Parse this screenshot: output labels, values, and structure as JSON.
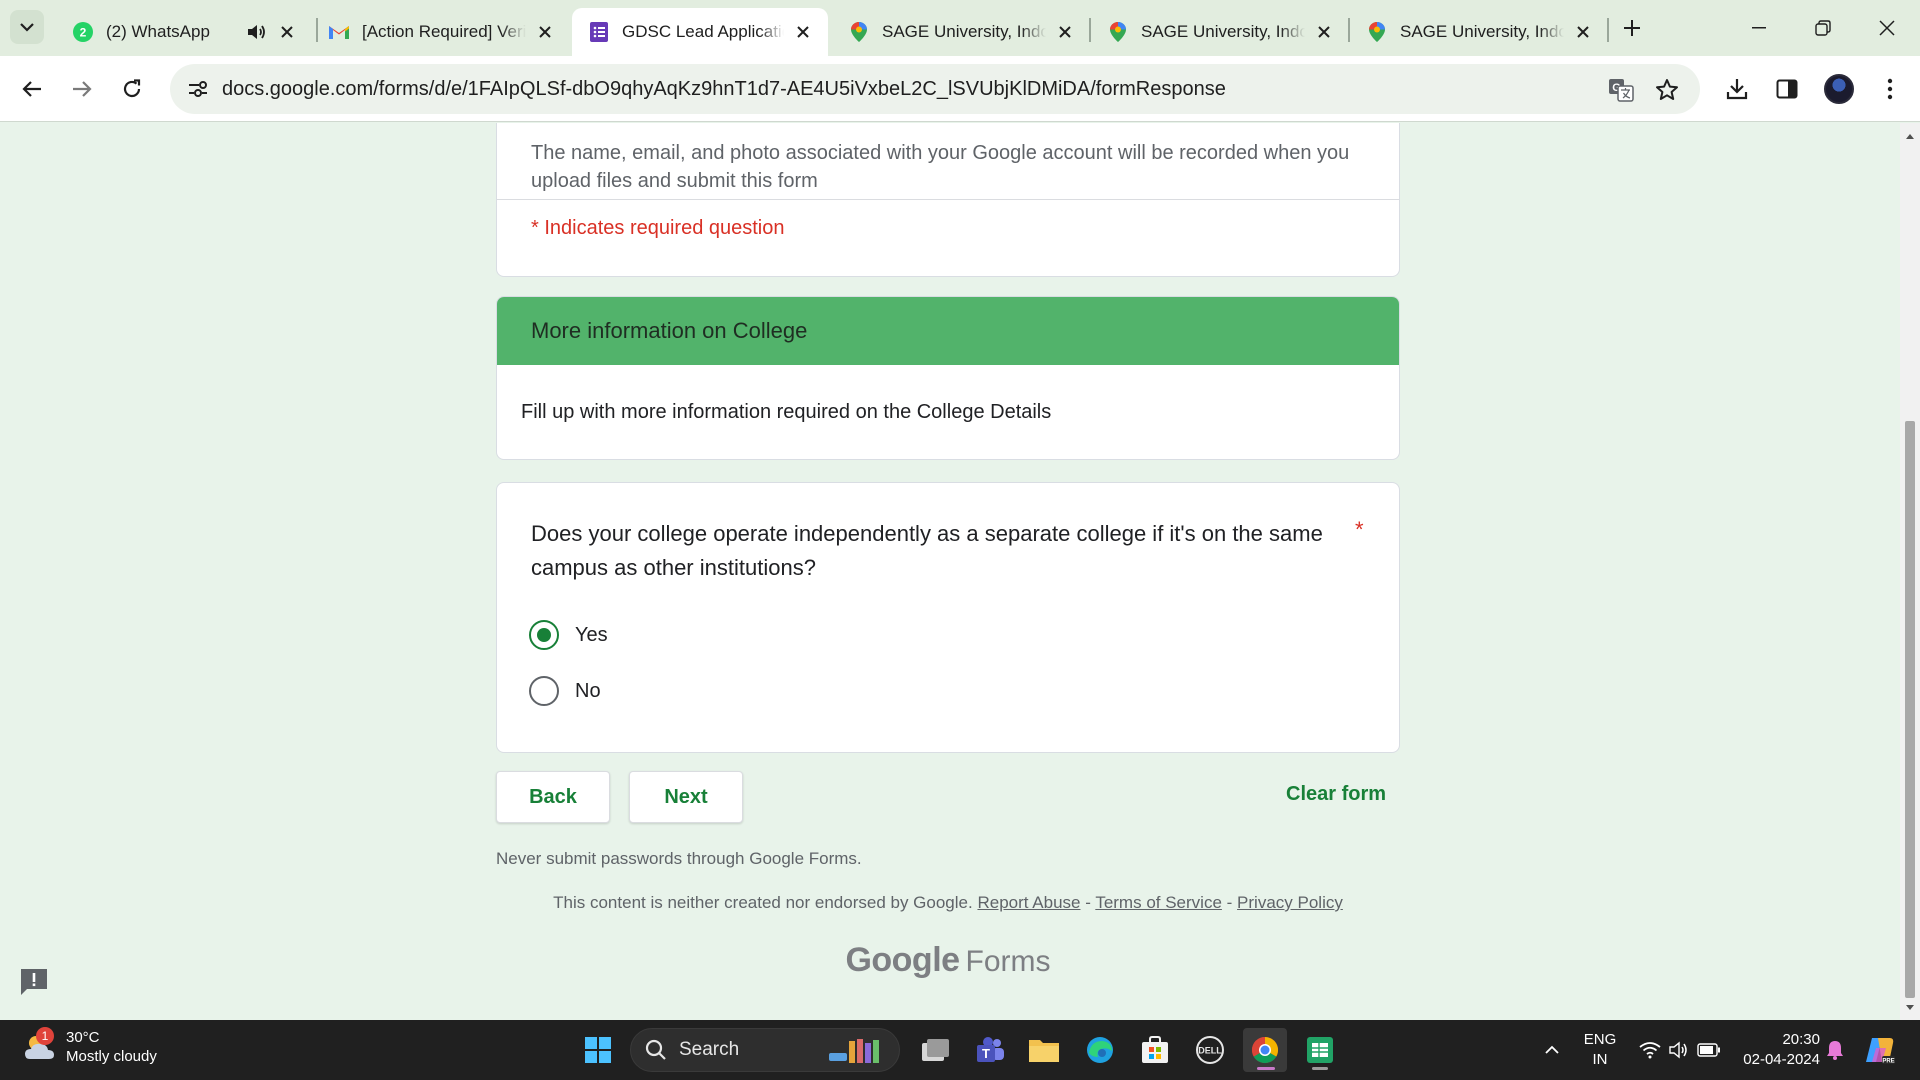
{
  "browser": {
    "tabs": [
      {
        "title": "(2) WhatsApp",
        "badge": "2",
        "audio": true
      },
      {
        "title": "[Action Required] Verify"
      },
      {
        "title": "GDSC Lead Application",
        "active": true
      },
      {
        "title": "SAGE University, Indore"
      },
      {
        "title": "SAGE University, Indore"
      },
      {
        "title": "SAGE University, Indore"
      }
    ],
    "url": "docs.google.com/forms/d/e/1FAIpQLSf-dbO9qhyAqKz9hnT1d7-AE4U5iVxbeL2C_lSVUbjKlDMiDA/formResponse"
  },
  "form": {
    "account_notice": "The name, email, and photo associated with your Google account will be recorded when you upload files and submit this form",
    "required_note": "* Indicates required question",
    "section": {
      "title": "More information on College",
      "description": "Fill up with more information required on the College Details"
    },
    "question": {
      "text": "Does your college operate independently as a separate college if it's on the same campus as other institutions?",
      "required_mark": "*",
      "options": [
        {
          "label": "Yes",
          "selected": true
        },
        {
          "label": "No",
          "selected": false
        }
      ]
    },
    "buttons": {
      "back": "Back",
      "next": "Next",
      "clear": "Clear form"
    },
    "password_warning": "Never submit passwords through Google Forms.",
    "disclaimer": {
      "text": "This content is neither created nor endorsed by Google.",
      "report": "Report Abuse",
      "sep": "-",
      "terms": "Terms of Service",
      "privacy": "Privacy Policy"
    },
    "brand": {
      "google": "Google",
      "forms": "Forms"
    }
  },
  "taskbar": {
    "weather_badge": "1",
    "temperature": "30°C",
    "condition": "Mostly cloudy",
    "search_label": "Search",
    "lang_line1": "ENG",
    "lang_line2": "IN",
    "time": "20:30",
    "date": "02-04-2024"
  },
  "colors": {
    "accent": "#188038",
    "section_header": "#52b36b",
    "page_background": "#e8f3ea",
    "required": "#d93025"
  }
}
